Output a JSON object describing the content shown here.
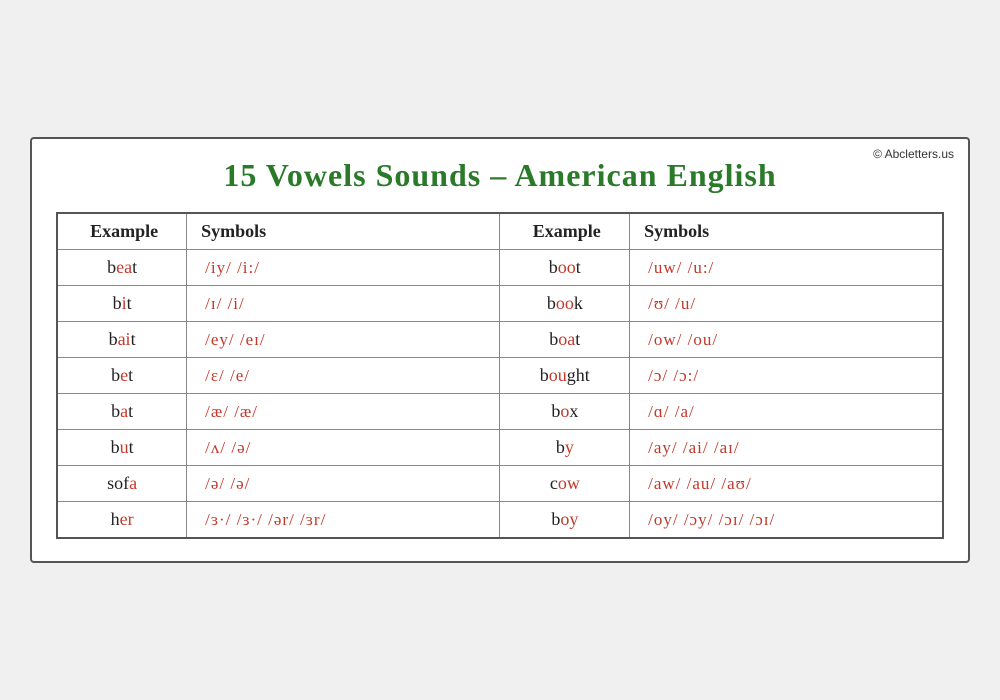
{
  "copyright": "© Abcletters.us",
  "title": "15 Vowels Sounds – American English",
  "headers": {
    "example": "Example",
    "symbols": "Symbols"
  },
  "rows": [
    {
      "left": {
        "word_pre": "b",
        "word_vowel": "ea",
        "word_post": "t",
        "symbols": "/iy/        /i:/"
      },
      "right": {
        "word_pre": "b",
        "word_vowel": "oo",
        "word_post": "t",
        "symbols": "/uw/      /u:/"
      }
    },
    {
      "left": {
        "word_pre": "b",
        "word_vowel": "i",
        "word_post": "t",
        "symbols": "/ɪ/         /i/"
      },
      "right": {
        "word_pre": "b",
        "word_vowel": "oo",
        "word_post": "k",
        "symbols": "/ʊ/        /u/"
      }
    },
    {
      "left": {
        "word_pre": "b",
        "word_vowel": "ai",
        "word_post": "t",
        "symbols": "/ey/    /eɪ/"
      },
      "right": {
        "word_pre": "b",
        "word_vowel": "oa",
        "word_post": "t",
        "symbols": "/ow/    /ou/"
      }
    },
    {
      "left": {
        "word_pre": "b",
        "word_vowel": "e",
        "word_post": "t",
        "symbols": "/ɛ/         /e/"
      },
      "right": {
        "word_pre": "b",
        "word_vowel": "ou",
        "word_post": "ght",
        "symbols": "/ɔ/          /ɔ:/"
      }
    },
    {
      "left": {
        "word_pre": "b",
        "word_vowel": "a",
        "word_post": "t",
        "symbols": "/æ/     /æ/"
      },
      "right": {
        "word_pre": "b",
        "word_vowel": "o",
        "word_post": "x",
        "symbols": "/ɑ/        /a/"
      }
    },
    {
      "left": {
        "word_pre": "b",
        "word_vowel": "u",
        "word_post": "t",
        "symbols": "/ʌ/         /ə/"
      },
      "right": {
        "word_pre": "b",
        "word_vowel": "y",
        "word_post": "",
        "symbols": "/ay/   /ai/   /aɪ/"
      }
    },
    {
      "left": {
        "word_pre": "sof",
        "word_vowel": "a",
        "word_post": "",
        "symbols": "/ə/          /ə/"
      },
      "right": {
        "word_pre": "c",
        "word_vowel": "ow",
        "word_post": "",
        "symbols": "/aw/  /au/  /aʊ/"
      }
    },
    {
      "left": {
        "word_pre": "h",
        "word_vowel": "er",
        "word_post": "",
        "symbols": "/ɜ·/  /ɜ·/  /ər/   /ɜr/"
      },
      "right": {
        "word_pre": "b",
        "word_vowel": "oy",
        "word_post": "",
        "symbols": "/oy/  /ɔy/  /ɔɪ/  /ɔɪ/"
      }
    }
  ]
}
